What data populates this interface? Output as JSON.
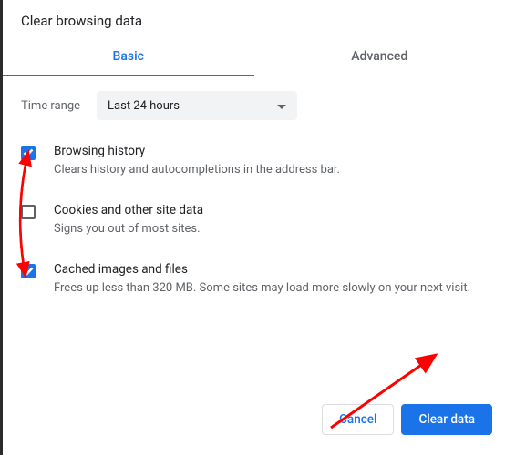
{
  "title": "Clear browsing data",
  "tabs": {
    "basic": "Basic",
    "advanced": "Advanced"
  },
  "time": {
    "label": "Time range",
    "value": "Last 24 hours"
  },
  "options": [
    {
      "checked": true,
      "title": "Browsing history",
      "desc": "Clears history and autocompletions in the address bar."
    },
    {
      "checked": false,
      "title": "Cookies and other site data",
      "desc": "Signs you out of most sites."
    },
    {
      "checked": true,
      "title": "Cached images and files",
      "desc": "Frees up less than 320 MB. Some sites may load more slowly on your next visit."
    }
  ],
  "buttons": {
    "cancel": "Cancel",
    "clear": "Clear data"
  }
}
